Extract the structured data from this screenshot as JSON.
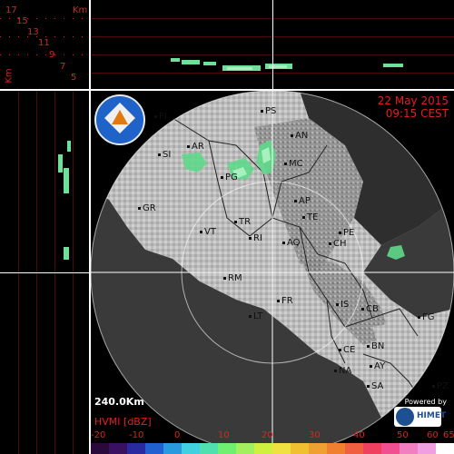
{
  "header": {
    "date": "22 May 2015",
    "time": "09:15 CEST"
  },
  "range_label": "240.0Km",
  "legend": {
    "title": "HVMI [dBZ]",
    "ticks": [
      "-20",
      "-10",
      "0",
      "10",
      "20",
      "30",
      "40",
      "50",
      "60",
      "65"
    ],
    "colors": [
      "#2a0a3a",
      "#3a1060",
      "#2a2aa0",
      "#2060d0",
      "#2a9ae0",
      "#40d0e0",
      "#50e0b0",
      "#70f070",
      "#a0f060",
      "#d0f040",
      "#f0e040",
      "#f0c030",
      "#f0a030",
      "#f08030",
      "#f06040",
      "#f04060",
      "#f05090",
      "#f080c0",
      "#f0a0e0",
      "#ffffff"
    ]
  },
  "height_axis": {
    "unit": "Km",
    "labels": [
      "17",
      "15",
      "13",
      "11",
      "9",
      "7",
      "5"
    ],
    "side_label": "Km"
  },
  "cities": [
    {
      "code": "FI"
    },
    {
      "code": "PS"
    },
    {
      "code": "AN"
    },
    {
      "code": "AR"
    },
    {
      "code": "SI"
    },
    {
      "code": "MC"
    },
    {
      "code": "PG"
    },
    {
      "code": "GR"
    },
    {
      "code": "AP"
    },
    {
      "code": "TE"
    },
    {
      "code": "TR"
    },
    {
      "code": "VT"
    },
    {
      "code": "RI"
    },
    {
      "code": "PE"
    },
    {
      "code": "AQ"
    },
    {
      "code": "CH"
    },
    {
      "code": "RM"
    },
    {
      "code": "FR"
    },
    {
      "code": "IS"
    },
    {
      "code": "CB"
    },
    {
      "code": "FG"
    },
    {
      "code": "LT"
    },
    {
      "code": "CE"
    },
    {
      "code": "BN"
    },
    {
      "code": "AY"
    },
    {
      "code": "NA"
    },
    {
      "code": "SA"
    },
    {
      "code": "PZ"
    }
  ],
  "logo": {
    "name": "protezione-civile-logo"
  },
  "powered_by": {
    "text": "Powered by",
    "brand": "HIMET"
  }
}
